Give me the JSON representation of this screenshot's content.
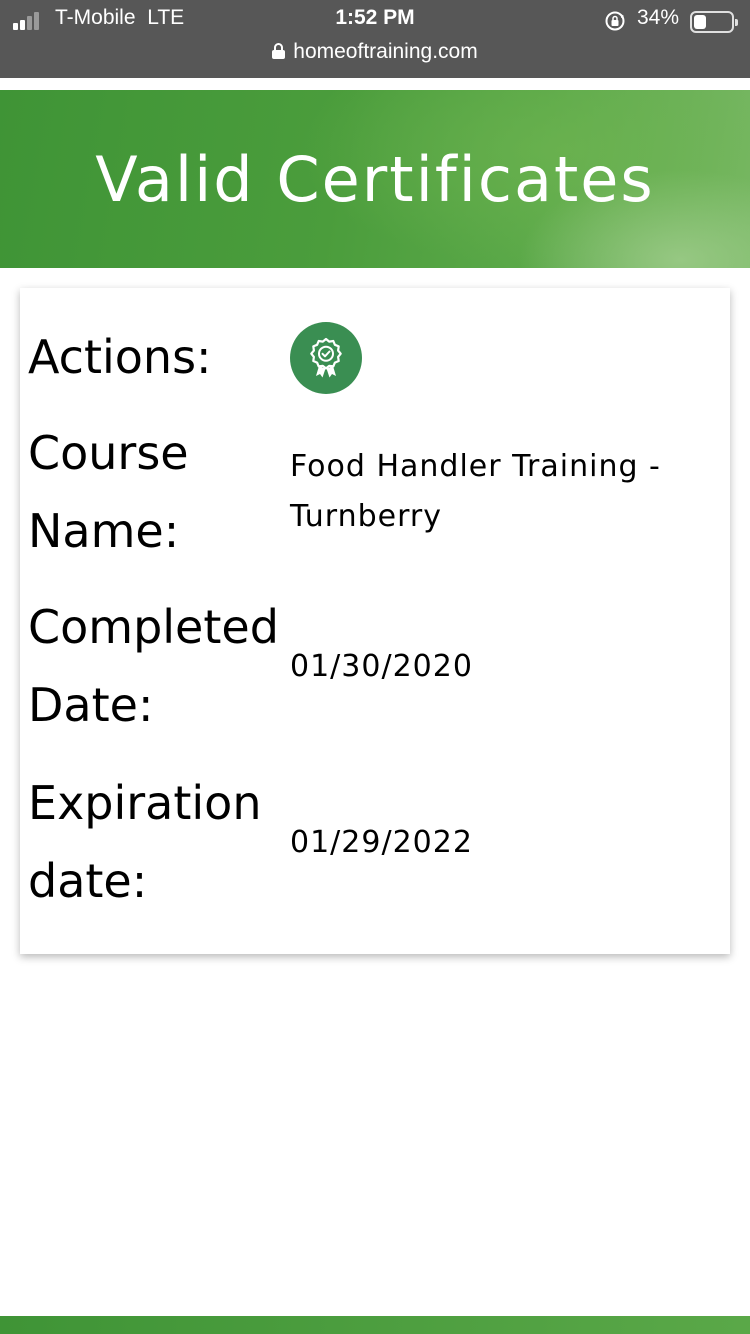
{
  "status_bar": {
    "carrier": "T-Mobile",
    "network": "LTE",
    "time": "1:52 PM",
    "battery_percent": "34%",
    "battery_level": 0.34,
    "url": "homeoftraining.com",
    "icons": [
      "signal-icon",
      "rotation-lock-icon",
      "battery-icon",
      "padlock-icon"
    ]
  },
  "header": {
    "title": "Valid Certificates",
    "color": "#4b9d3c"
  },
  "certificate": {
    "actions_label": "Actions:",
    "action_icon": "certificate-badge-icon",
    "action_color": "#3a8e52",
    "course_label_1": "Course",
    "course_label_2": "Name:",
    "course_name_1": "Food Handler Training -",
    "course_name_2": "Turnberry",
    "completed_label_1": "Completed",
    "completed_label_2": "Date:",
    "completed_date": "01/30/2020",
    "expiration_label_1": "Expiration",
    "expiration_label_2": "date:",
    "expiration_date": "01/29/2022"
  }
}
